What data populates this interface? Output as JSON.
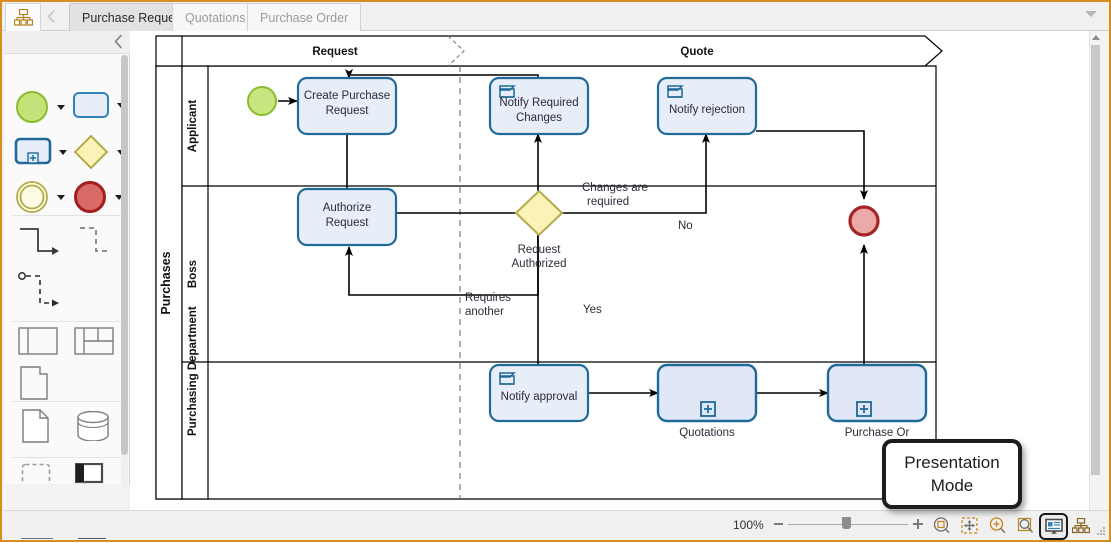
{
  "window": {
    "app_icon": "hierarchy-icon",
    "back_icon": "back-arrow-icon",
    "dropdown_icon": "chevron-down-icon"
  },
  "tabs": [
    {
      "label": "Purchase Request",
      "active": true
    },
    {
      "label": "Quotations",
      "active": false
    },
    {
      "label": "Purchase Order",
      "active": false
    }
  ],
  "palette": {
    "collapse_icon": "chevron-left-icon",
    "groups": [
      {
        "name": "events-activities",
        "items": [
          {
            "icon": "start-event-circle-icon",
            "caret": true
          },
          {
            "icon": "task-rounded-rect-icon",
            "caret": true
          },
          {
            "icon": "expanded-subprocess-icon",
            "caret": true
          },
          {
            "icon": "gateway-diamond-icon",
            "caret": true
          },
          {
            "icon": "intermediate-event-icon",
            "caret": true
          },
          {
            "icon": "end-event-circle-icon",
            "caret": true
          }
        ]
      },
      {
        "name": "connectors",
        "items": [
          {
            "icon": "sequence-flow-icon",
            "caret": false
          },
          {
            "icon": "message-flow-icon",
            "caret": false
          },
          {
            "icon": "association-flow-icon",
            "caret": false
          }
        ]
      },
      {
        "name": "pools-lanes",
        "items": [
          {
            "icon": "pool-horizontal-icon",
            "caret": false
          },
          {
            "icon": "pool-grid-icon",
            "caret": false
          },
          {
            "icon": "lane-icon",
            "caret": false
          }
        ]
      },
      {
        "name": "data",
        "items": [
          {
            "icon": "data-object-icon",
            "caret": false
          },
          {
            "icon": "data-store-icon",
            "caret": false
          }
        ]
      },
      {
        "name": "artifacts",
        "items": [
          {
            "icon": "group-dashed-icon",
            "caret": false
          },
          {
            "icon": "text-annotation-icon",
            "caret": false
          },
          {
            "icon": "image-icon",
            "caret": false
          },
          {
            "icon": "container-icon",
            "caret": false
          }
        ]
      }
    ]
  },
  "diagram": {
    "pool_label": "Purchases",
    "lanes": [
      {
        "label": "Applicant"
      },
      {
        "label": "Boss"
      },
      {
        "label": "Purchasing Department"
      }
    ],
    "phases": [
      {
        "label": "Request"
      },
      {
        "label": "Quote"
      }
    ],
    "nodes": [
      {
        "id": "start",
        "type": "start-event",
        "label": ""
      },
      {
        "id": "create",
        "type": "task",
        "label": "Create Purchase Request"
      },
      {
        "id": "notifychg",
        "type": "send-task",
        "label": "Notify Required Changes"
      },
      {
        "id": "notifyrej",
        "type": "send-task",
        "label": "Notify rejection"
      },
      {
        "id": "authorize",
        "type": "task",
        "label": "Authorize Request"
      },
      {
        "id": "gateway",
        "type": "exclusive-gateway",
        "label": "Request Authorized"
      },
      {
        "id": "end",
        "type": "end-event",
        "label": ""
      },
      {
        "id": "notifyapp",
        "type": "send-task",
        "label": "Notify approval"
      },
      {
        "id": "quotations",
        "type": "subprocess",
        "label": "Quotations"
      },
      {
        "id": "porder",
        "type": "subprocess",
        "label": "Purchase Or"
      }
    ],
    "edge_labels": [
      {
        "text": "Changes are required"
      },
      {
        "text": "No"
      },
      {
        "text": "Yes"
      },
      {
        "text": "Requires another"
      }
    ],
    "colors": {
      "task_fill": "#e8edfa",
      "task_stroke": "#1f6a96",
      "start_fill": "#c3e37a",
      "start_stroke": "#86bb2a",
      "end_fill": "#eba9a7",
      "end_stroke": "#a52424",
      "gateway_fill": "#fbf2b8",
      "gateway_stroke": "#b3ac4a",
      "flow": "#000000"
    }
  },
  "statusbar": {
    "zoom_level": "100%",
    "slider": {
      "minus": "−",
      "plus": "+"
    },
    "buttons": [
      {
        "name": "zoom-to-page-icon",
        "selected": false
      },
      {
        "name": "fit-to-window-icon",
        "selected": false
      },
      {
        "name": "zoom-in-icon",
        "selected": false
      },
      {
        "name": "zoom-area-icon",
        "selected": false
      },
      {
        "name": "presentation-mode-icon",
        "selected": true
      },
      {
        "name": "outline-view-icon",
        "selected": false
      }
    ]
  },
  "tooltip": {
    "text": "Presentation Mode"
  }
}
